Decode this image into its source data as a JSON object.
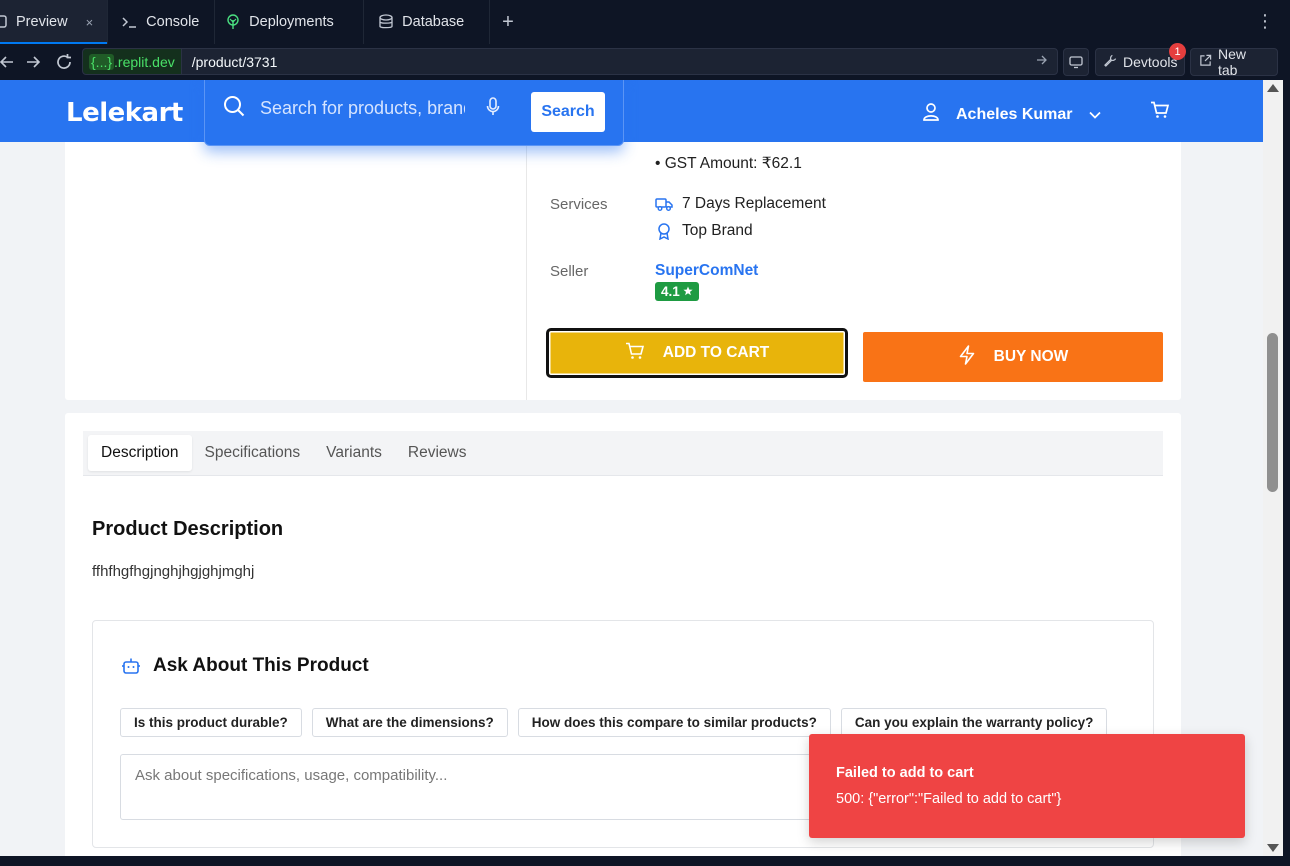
{
  "ide": {
    "tabs": [
      {
        "label": "Preview",
        "icon": "preview-icon",
        "active": true,
        "close": "×"
      },
      {
        "label": "Console",
        "icon": "terminal-icon"
      },
      {
        "label": "Deployments",
        "icon": "deployments-icon"
      },
      {
        "label": "Database",
        "icon": "database-icon"
      }
    ],
    "add_tab": "+",
    "more": "⋮",
    "url": {
      "domain_chip": "{...}",
      "domain_suffix": ".replit.dev",
      "path": "/product/3731"
    },
    "devtools_label": "Devtools",
    "devtools_badge": "1",
    "newtab_label": "New tab"
  },
  "header": {
    "logo": "Lelekart",
    "search_placeholder": "Search for products, brands",
    "search_button": "Search",
    "user_name": "Acheles Kumar",
    "accent": "#2874f0"
  },
  "product": {
    "gst": "• GST Amount: ₹62.1",
    "services_label": "Services",
    "services": [
      "7 Days Replacement",
      "Top Brand"
    ],
    "seller_label": "Seller",
    "seller_name": "SuperComNet",
    "seller_rating": "4.1",
    "add_to_cart": "ADD TO CART",
    "buy_now": "BUY NOW"
  },
  "info": {
    "tabs": [
      "Description",
      "Specifications",
      "Variants",
      "Reviews"
    ],
    "active_tab": "Description",
    "desc_title": "Product Description",
    "desc_text": "ffhfhgfhgjnghjhgjghjmghj",
    "ask_title": "Ask About This Product",
    "chips": [
      "Is this product durable?",
      "What are the dimensions?",
      "How does this compare to similar products?",
      "Can you explain the warranty policy?"
    ],
    "ask_placeholder": "Ask about specifications, usage, compatibility..."
  },
  "toast": {
    "title": "Failed to add to cart",
    "description": "500: {\"error\":\"Failed to add to cart\"}",
    "color": "#ef4444"
  }
}
